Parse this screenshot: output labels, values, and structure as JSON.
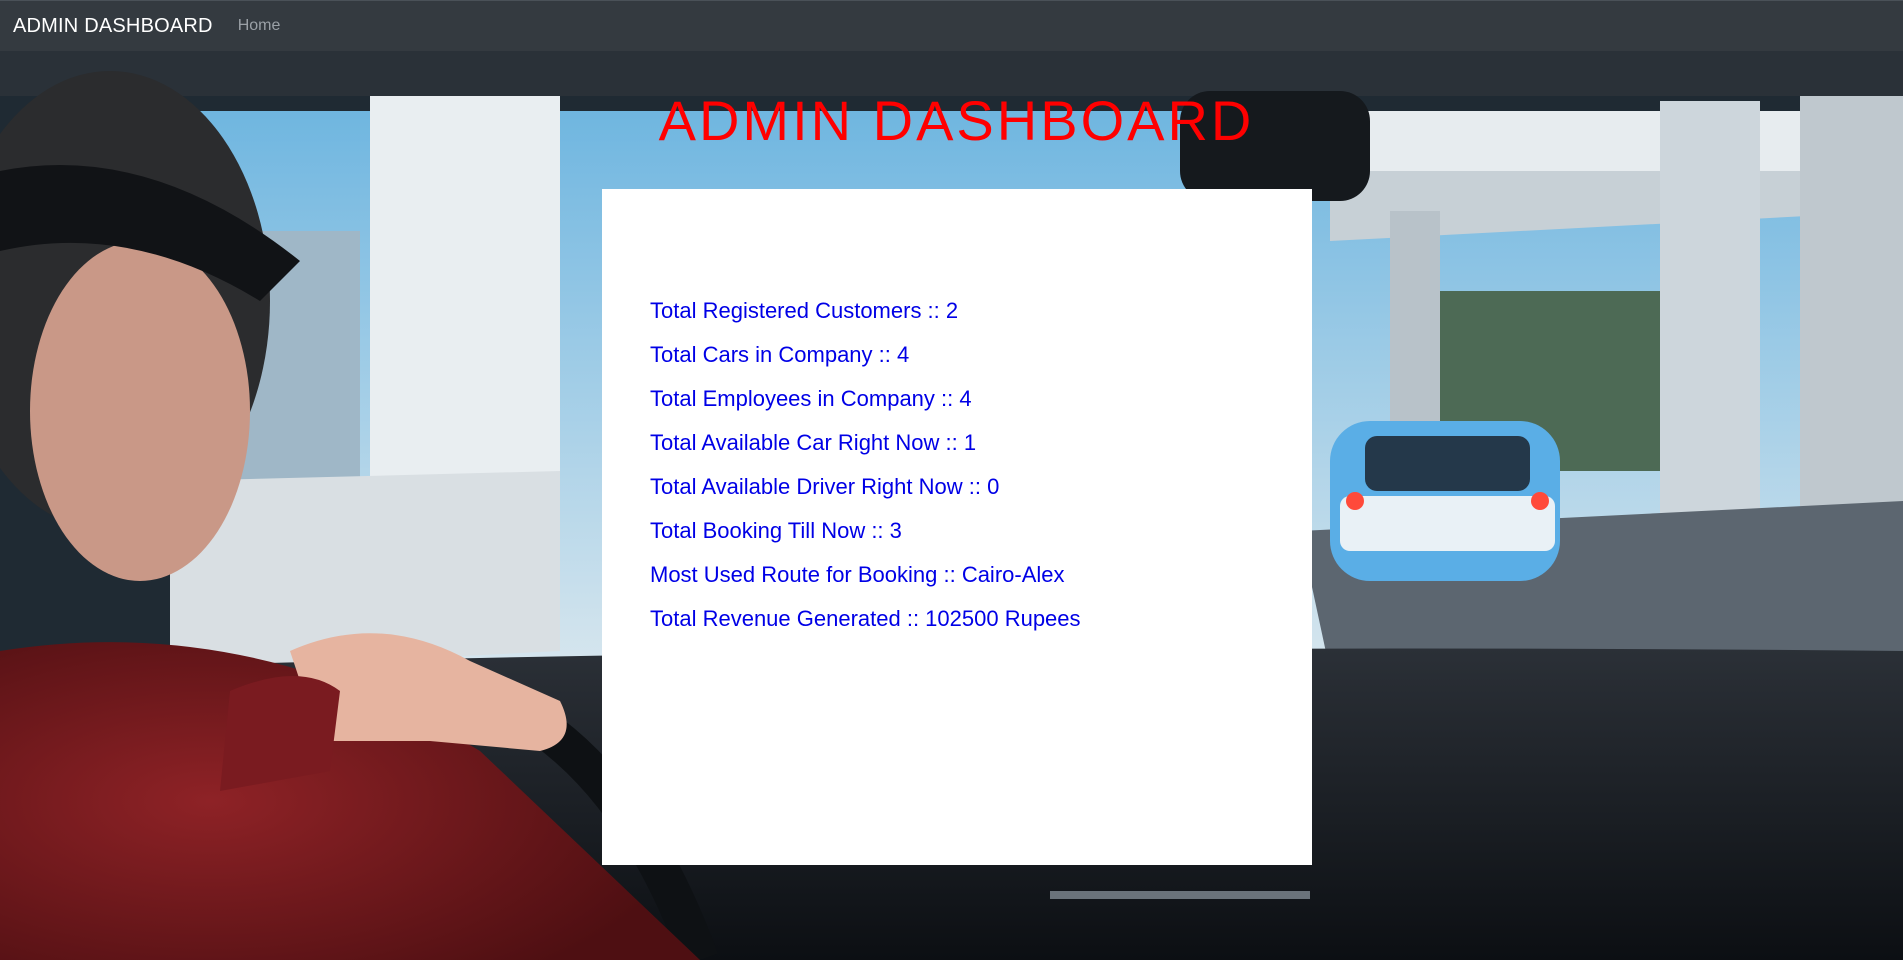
{
  "navbar": {
    "brand": "ADMIN DASHBOARD",
    "links": [
      "Home"
    ]
  },
  "page": {
    "heading": "ADMIN DASHBOARD",
    "heading_color": "#ff0000"
  },
  "stats": [
    "Total Registered Customers :: 2",
    "Total Cars in Company :: 4",
    "Total Employees in Company :: 4",
    "Total Available Car Right Now :: 1",
    "Total Available Driver Right Now :: 0",
    "Total Booking Till Now :: 3",
    "Most Used Route for Booking :: Cairo-Alex",
    "Total Revenue Generated :: 102500 Rupees"
  ],
  "colors": {
    "navbar_bg": "#343a40",
    "stat_text": "#0000e6"
  }
}
